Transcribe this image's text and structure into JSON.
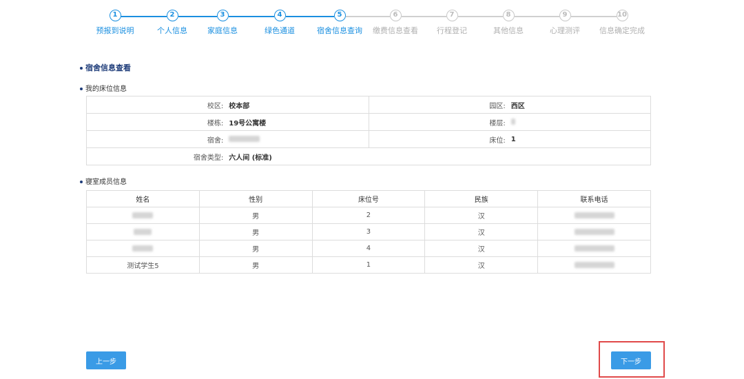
{
  "stepper": {
    "steps": [
      {
        "num": "1",
        "label": "预报到说明",
        "active": true
      },
      {
        "num": "2",
        "label": "个人信息",
        "active": true
      },
      {
        "num": "3",
        "label": "家庭信息",
        "active": true
      },
      {
        "num": "4",
        "label": "绿色通道",
        "active": true
      },
      {
        "num": "5",
        "label": "宿舍信息查询",
        "active": true
      },
      {
        "num": "6",
        "label": "缴费信息查看",
        "active": false
      },
      {
        "num": "7",
        "label": "行程登记",
        "active": false
      },
      {
        "num": "8",
        "label": "其他信息",
        "active": false
      },
      {
        "num": "9",
        "label": "心理测评",
        "active": false
      },
      {
        "num": "10",
        "label": "信息确定完成",
        "active": false
      }
    ]
  },
  "page": {
    "section_title": "宿舍信息查看",
    "bed_info_title": "我的床位信息",
    "members_title": "寝室成员信息"
  },
  "bed_info": {
    "campus_label": "校区:",
    "campus_value": "校本部",
    "zone_label": "园区:",
    "zone_value": "西区",
    "building_label": "楼栋:",
    "building_value": "19号公寓楼",
    "floor_label": "楼层:",
    "room_label": "宿舍:",
    "bed_label": "床位:",
    "bed_value": "1",
    "type_label": "宿舍类型:",
    "type_value": "六人间 (标准)"
  },
  "members": {
    "headers": [
      "姓名",
      "性别",
      "床位号",
      "民族",
      "联系电话"
    ],
    "rows": [
      {
        "name": "",
        "gender": "男",
        "bed": "2",
        "ethnicity": "汉",
        "phone": ""
      },
      {
        "name": "",
        "gender": "男",
        "bed": "3",
        "ethnicity": "汉",
        "phone": ""
      },
      {
        "name": "",
        "gender": "男",
        "bed": "4",
        "ethnicity": "汉",
        "phone": ""
      },
      {
        "name": "测试学生5",
        "gender": "男",
        "bed": "1",
        "ethnicity": "汉",
        "phone": ""
      }
    ]
  },
  "buttons": {
    "prev_label": "上一步",
    "next_label": "下一步"
  },
  "colors": {
    "accent": "#1a8fe0",
    "button": "#3a9be6",
    "highlight": "#e04848"
  }
}
